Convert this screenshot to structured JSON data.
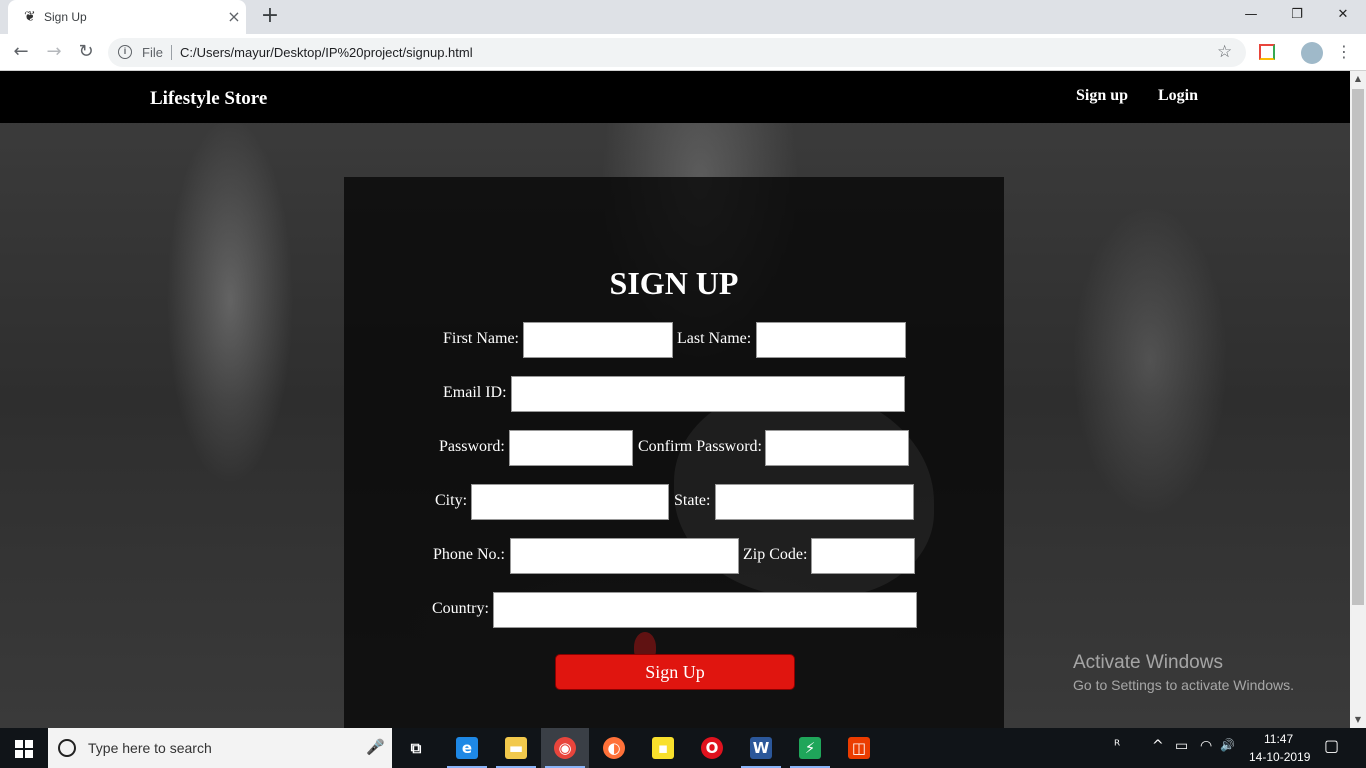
{
  "browser": {
    "tab_title": "Sign Up",
    "tab_close": "×",
    "new_tab": "+",
    "controls": {
      "minimize": "—",
      "restore": "❐",
      "close": "✕"
    },
    "nav": {
      "back": "←",
      "forward": "→",
      "reload": "↻"
    },
    "omnibox": {
      "info": "i",
      "scheme_label": "File",
      "url": "C:/Users/mayur/Desktop/IP%20project/signup.html"
    },
    "bookmark_star": "☆",
    "menu": "⋮"
  },
  "site": {
    "brand": "Lifestyle Store",
    "nav_links": [
      "Sign up",
      "Login"
    ]
  },
  "form": {
    "title": "SIGN UP",
    "fields": {
      "first_name": "First Name:",
      "last_name": "Last Name:",
      "email": "Email ID:",
      "password": "Password:",
      "confirm_password": "Confirm Password:",
      "city": "City:",
      "state": "State:",
      "phone": "Phone No.:",
      "zip": "Zip Code:",
      "country": "Country:"
    },
    "submit_label": "Sign Up"
  },
  "watermark": {
    "title": "Activate Windows",
    "subtitle": "Go to Settings to activate Windows."
  },
  "scrollbar": {
    "up": "▲",
    "down": "▼"
  },
  "taskbar": {
    "search_placeholder": "Type here to search",
    "mic": "🎤",
    "apps": [
      {
        "name": "task-view",
        "glyph": "⧉",
        "color": "#101418"
      },
      {
        "name": "edge",
        "glyph": "e",
        "color": "#1e88e5"
      },
      {
        "name": "file-explorer",
        "glyph": "▬",
        "color": "#f2c94c"
      },
      {
        "name": "chrome",
        "glyph": "◉",
        "color": "#e8453c"
      },
      {
        "name": "firefox",
        "glyph": "◐",
        "color": "#ff7139"
      },
      {
        "name": "sticky-notes",
        "glyph": "▪",
        "color": "#f9e02c"
      },
      {
        "name": "opera",
        "glyph": "O",
        "color": "#e0121e"
      },
      {
        "name": "word",
        "glyph": "W",
        "color": "#2b579a"
      },
      {
        "name": "security-shield",
        "glyph": "⚡",
        "color": "#1fa65a"
      },
      {
        "name": "office",
        "glyph": "◫",
        "color": "#eb3c00"
      }
    ],
    "tray": {
      "people": "ᴿ",
      "chevron": "^",
      "battery": "▭",
      "wifi": "◠",
      "volume": "🔊"
    },
    "clock": {
      "time": "11:47",
      "date": "14-10-2019"
    },
    "notifications": "▢"
  }
}
